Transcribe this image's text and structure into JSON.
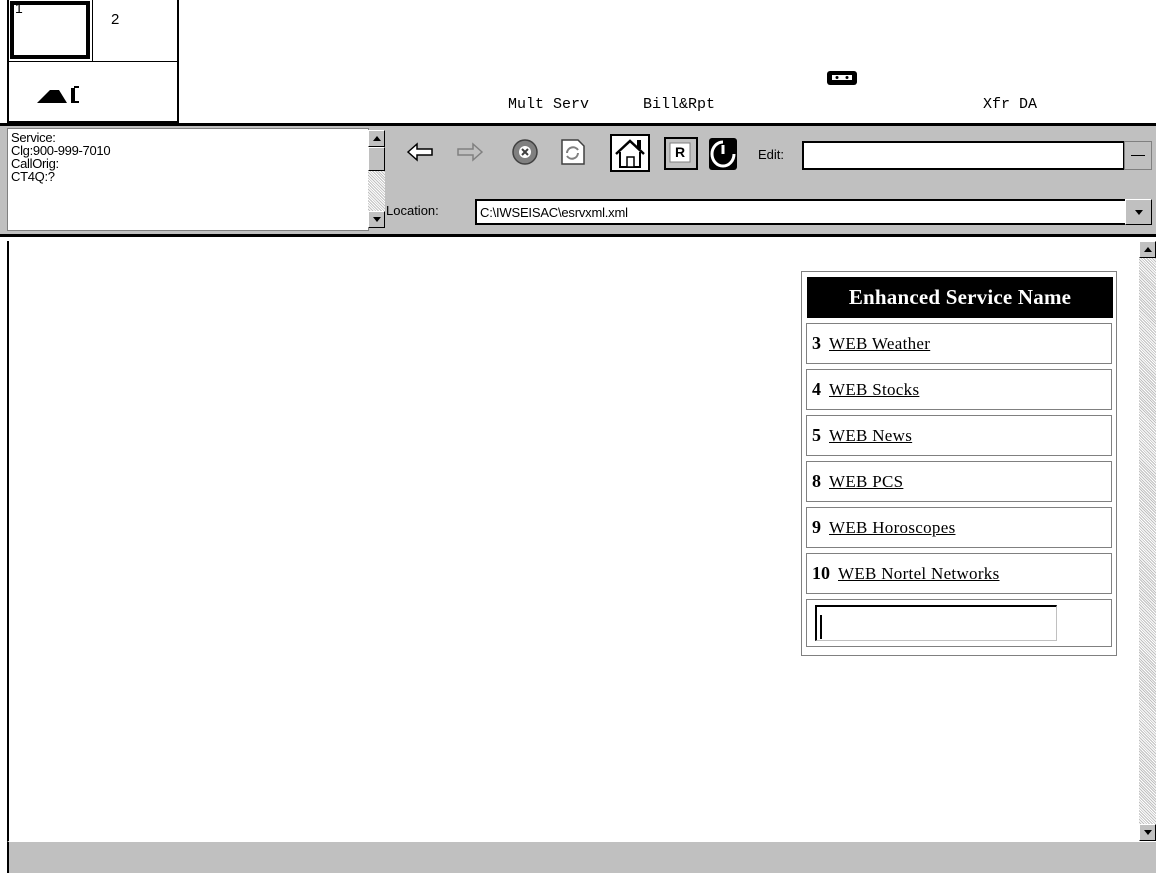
{
  "lines": {
    "line_1": "1",
    "line_2": "2"
  },
  "softkeys": {
    "mult_serv": "Mult Serv",
    "bill_rpt": "Bill&Rpt",
    "xfr_da": "Xfr DA"
  },
  "call_info": {
    "service": "Service:",
    "calling": "Clg:900-999-7010",
    "call_orig": "CallOrig:",
    "ct4q": "CT4Q:?"
  },
  "toolbar": {
    "edit_label": "Edit:",
    "edit_value": "",
    "location_label": "Location:",
    "location_value": "C:\\IWSEISAC\\esrvxml.xml",
    "reload_label": "R",
    "icons": [
      "back-arrow",
      "forward-arrow",
      "stop",
      "refresh",
      "home",
      "reload",
      "timer"
    ]
  },
  "service_table": {
    "header": "Enhanced Service Name",
    "rows": [
      {
        "number": "3",
        "name": "WEB Weather"
      },
      {
        "number": "4",
        "name": "WEB Stocks"
      },
      {
        "number": "5",
        "name": "WEB News"
      },
      {
        "number": "8",
        "name": "WEB PCS"
      },
      {
        "number": "9",
        "name": "WEB Horoscopes"
      },
      {
        "number": "10",
        "name": "WEB Nortel Networks"
      }
    ],
    "input_value": ""
  },
  "colors": {
    "chrome": "#c0c0c0",
    "header_bg": "#000000",
    "header_text": "#ffffff"
  }
}
